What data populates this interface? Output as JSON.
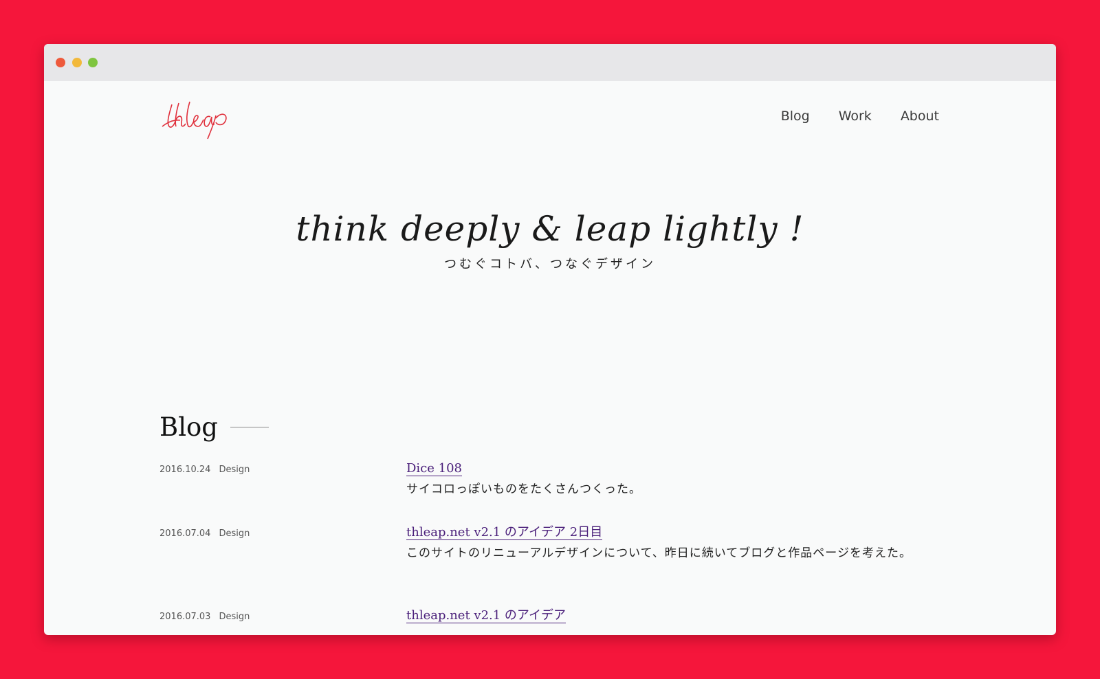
{
  "colors": {
    "background": "#f5163b",
    "page": "#f9fafa",
    "titlebar": "#e7e7e9",
    "logo": "#e0303c",
    "link": "#4a1f7a",
    "traffic_red": "#ee5a3c",
    "traffic_yellow": "#f2b93b",
    "traffic_green": "#7fc53f"
  },
  "logo": {
    "alt": "thleap"
  },
  "nav": {
    "items": [
      {
        "label": "Blog"
      },
      {
        "label": "Work"
      },
      {
        "label": "About"
      }
    ]
  },
  "hero": {
    "tagline": "think deeply & leap lightly !",
    "subtitle": "つむぐコトバ、つなぐデザイン"
  },
  "blog": {
    "heading": "Blog",
    "posts": [
      {
        "date": "2016.10.24",
        "category": "Design",
        "title": "Dice 108",
        "excerpt": "サイコロっぽいものをたくさんつくった。"
      },
      {
        "date": "2016.07.04",
        "category": "Design",
        "title": "thleap.net v2.1 のアイデア 2日目",
        "excerpt": "このサイトのリニューアルデザインについて、昨日に続いてブログと作品ページを考えた。"
      },
      {
        "date": "2016.07.03",
        "category": "Design",
        "title": "thleap.net v2.1 のアイデア",
        "excerpt": ""
      }
    ]
  }
}
